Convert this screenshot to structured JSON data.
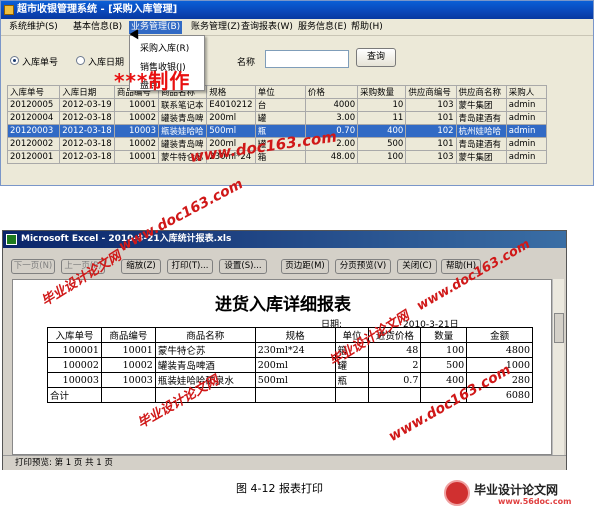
{
  "app1": {
    "title": "超市收银管理系统 - [采购入库管理]",
    "menu": [
      "系统维护(S)",
      "基本信息(B)",
      "业务管理(B)",
      "账务管理(Z)",
      "查询报表(W)",
      "服务信息(E)",
      "帮助(H)"
    ],
    "dropdown": [
      "采购入库(R)",
      "销售收银(J)",
      "盘点"
    ],
    "radio_labels": [
      "入库单号",
      "入库日期"
    ],
    "search_label": "名称",
    "query_button": "查询",
    "stars_text": "***制作",
    "grid": {
      "headers": [
        "入库单号",
        "入库日期",
        "商品编号",
        "商品名称",
        "规格",
        "单位",
        "价格",
        "采购数量",
        "供应商编号",
        "供应商名称",
        "采购人"
      ],
      "rows": [
        [
          "20120005",
          "2012-03-19",
          "10001",
          "联系笔记本",
          "E4010212",
          "台",
          "4000",
          "10",
          "103",
          "蒙牛集团",
          "admin"
        ],
        [
          "20120004",
          "2012-03-18",
          "10002",
          "罐装青岛啤",
          "200ml",
          "罐",
          "3.00",
          "11",
          "101",
          "青岛建酒有",
          "admin"
        ],
        [
          "20120003",
          "2012-03-18",
          "10003",
          "瓶装娃哈哈",
          "500ml",
          "瓶",
          "0.70",
          "400",
          "102",
          "杭州娃哈哈",
          "admin"
        ],
        [
          "20120002",
          "2012-03-18",
          "10002",
          "罐装青岛啤",
          "200ml",
          "罐",
          "2.00",
          "500",
          "101",
          "青岛建酒有",
          "admin"
        ],
        [
          "20120001",
          "2012-03-18",
          "10001",
          "蒙牛特仑苏",
          "230ml*24",
          "箱",
          "48.00",
          "100",
          "103",
          "蒙牛集团",
          "admin"
        ]
      ],
      "selected_row": 2
    }
  },
  "app2": {
    "title": "Microsoft Excel - 2010-3-21入库统计报表.xls",
    "toolbar": [
      "下一页(N)",
      "上一页(P)",
      "缩放(Z)",
      "打印(T)...",
      "设置(S)...",
      "页边距(M)",
      "分页预览(V)",
      "关闭(C)",
      "帮助(H)"
    ],
    "report_title": "进货入库详细报表",
    "date_label": "日期:",
    "date_value": "2010-3-21日",
    "headers": [
      "入库单号",
      "商品编号",
      "商品名称",
      "规格",
      "单位",
      "进货价格",
      "数量",
      "金额"
    ],
    "rows": [
      [
        "100001",
        "10001",
        "蒙牛特仑苏",
        "230ml*24",
        "箱",
        "48",
        "100",
        "4800"
      ],
      [
        "100002",
        "10002",
        "罐装青岛啤酒",
        "200ml",
        "罐",
        "2",
        "500",
        "1000"
      ],
      [
        "100003",
        "10003",
        "瓶装娃哈哈矿泉水",
        "500ml",
        "瓶",
        "0.7",
        "400",
        "280"
      ]
    ],
    "total_label": "合计",
    "total_value": "6080",
    "status": "打印预览: 第 1 页   共 1 页"
  },
  "watermarks": {
    "url": "www.doc163.com",
    "cn": "毕业设计论文网",
    "url2": "www.56doc.com"
  },
  "caption": "图 4-12  报表打印"
}
